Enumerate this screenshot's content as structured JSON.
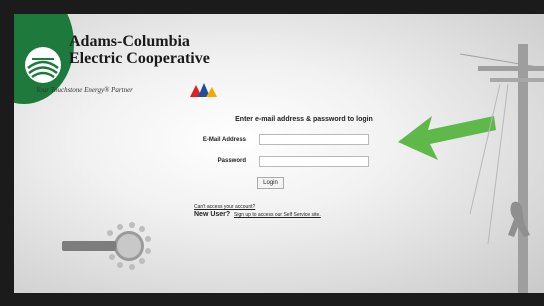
{
  "brand": {
    "name_line1": "Adams-Columbia",
    "name_line2": "Electric Cooperative",
    "tagline": "Your Touchstone Energy® Partner",
    "accent_color": "#1e7a3c",
    "arrow_color": "#5fb84a"
  },
  "login": {
    "heading": "Enter e-mail address & password to login",
    "email_label": "E-Mail Address",
    "email_value": "",
    "password_label": "Password",
    "password_value": "",
    "submit_label": "Login"
  },
  "links": {
    "access_account": "Can't access your account?",
    "new_user_label": "New User?",
    "new_user_link": "Sign up to access our Self Service site."
  },
  "icons": {
    "logo": "co-op-emblem-icon",
    "touchstone": "touchstone-energy-logo",
    "hub": "energy-hub-logo",
    "arrow": "green-arrow-icon",
    "pole": "utility-pole-illustration"
  }
}
